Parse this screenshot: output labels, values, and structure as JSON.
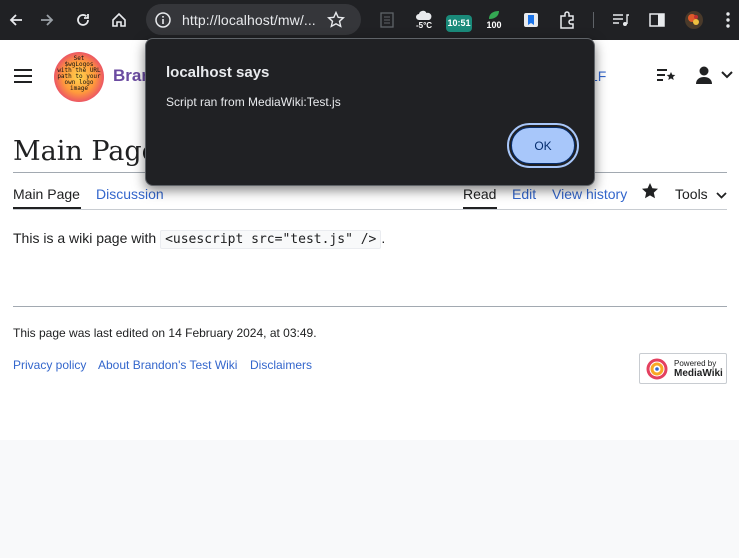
{
  "browser": {
    "url": "http://localhost/mw/...",
    "weather": "-5°C",
    "clock": "10:51",
    "badge_count": "100"
  },
  "header": {
    "site_name": "Brand",
    "logo_text": [
      "Set",
      "$wgLogos",
      "with the URL",
      "path to your",
      "own logo",
      "image"
    ],
    "username": "onXLF"
  },
  "page": {
    "title": "Main Page",
    "tabs": {
      "main_page": "Main Page",
      "discussion": "Discussion",
      "read": "Read",
      "edit": "Edit",
      "view_history": "View history",
      "tools": "Tools"
    },
    "content_prefix": "This is a wiki page with",
    "content_code": "<usescript src=\"test.js\" />",
    "content_suffix": "."
  },
  "footer": {
    "last_modified": "This page was last edited on 14 February 2024, at 03:49.",
    "links": [
      "Privacy policy",
      "About Brandon's Test Wiki",
      "Disclaimers"
    ],
    "powered_by_line1": "Powered by",
    "powered_by_line2": "MediaWiki"
  },
  "dialog": {
    "title": "localhost says",
    "message": "Script ran from MediaWiki:Test.js",
    "ok_label": "OK"
  },
  "colors": {
    "link": "#3366cc",
    "site_name": "#6b4ba1",
    "dialog_bg": "#202124",
    "ok_button": "#a8c7fa"
  }
}
